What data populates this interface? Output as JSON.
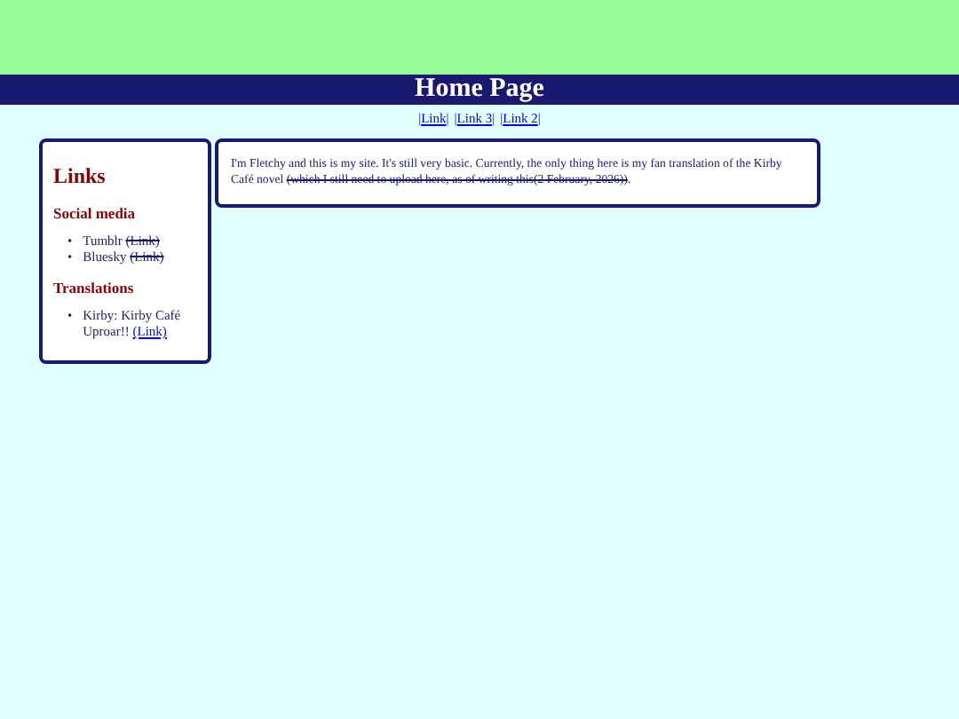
{
  "header": {
    "title": "Home Page"
  },
  "nav": [
    {
      "open": "|",
      "label": "Link",
      "close": "|"
    },
    {
      "open": "|",
      "label": "Link 3",
      "close": "|"
    },
    {
      "open": "|",
      "label": "Link 2",
      "close": "|"
    }
  ],
  "sidebar": {
    "title": "Links",
    "sections": [
      {
        "heading": "Social media",
        "items": [
          {
            "bullet": "•",
            "text": "Tumblr",
            "link": "(Link)",
            "struck": true
          },
          {
            "bullet": "•",
            "text": "Bluesky",
            "link": "(Link)",
            "struck": true
          }
        ]
      },
      {
        "heading": "Translations",
        "items": [
          {
            "bullet": "•",
            "text": "Kirby: Kirby Café Uproar!!",
            "link": "(Link)",
            "struck": false
          }
        ]
      }
    ]
  },
  "main": {
    "intro": "I'm Fletchy and this is my site. It's still very basic. Currently, the only thing here is my fan translation of the Kirby Café novel ",
    "struck": "(which I still need to upload here, as of writing this(2 February, 2026))",
    "end": "."
  }
}
